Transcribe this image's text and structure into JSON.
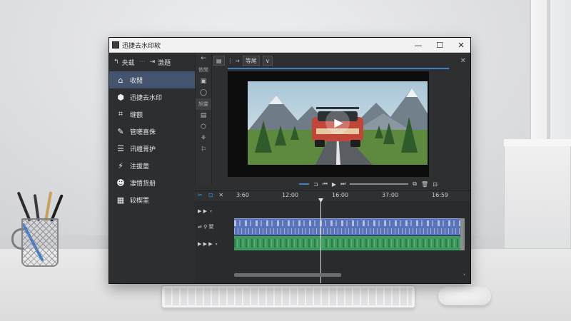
{
  "window": {
    "title": "迅捷去水印软",
    "controls": {
      "minimize": "—",
      "maximize": "☐",
      "close": "✕"
    }
  },
  "sidebar": {
    "top": {
      "back_label": "央载",
      "sep": "⋯",
      "right_label": "激題"
    },
    "items": [
      {
        "label": "收閒",
        "icon": "home-icon",
        "active": true
      },
      {
        "label": "迅捷去水印",
        "icon": "cube-icon",
        "active": false
      },
      {
        "label": "缝额",
        "icon": "crop-icon",
        "active": false
      },
      {
        "label": "管嗟喜侏",
        "icon": "edit-icon",
        "active": false
      },
      {
        "label": "讯缠膏护",
        "icon": "list-icon",
        "active": false
      },
      {
        "label": "注拔童",
        "icon": "wand-icon",
        "active": false
      },
      {
        "label": "凄悟货册",
        "icon": "people-icon",
        "active": false
      },
      {
        "label": "较楔罜",
        "icon": "grid-icon",
        "active": false
      }
    ]
  },
  "tools": {
    "back": "←",
    "items": [
      "侬閒",
      "▣",
      "◯",
      "旭靈",
      "▤",
      "⬡",
      "⚘",
      "⚐"
    ]
  },
  "preview_bar": {
    "left_icon": "⋮ →",
    "dropdown_label": "等尾",
    "dropdown_arrow": "∨",
    "close": "✕"
  },
  "transport": {
    "icons": [
      "⊐",
      "⏮",
      "▶",
      "⏭",
      "⧉",
      "🗑",
      "⊡"
    ]
  },
  "timeline": {
    "ticks": [
      "3:60",
      "12:00",
      "16:00",
      "37:00",
      "16:59"
    ],
    "tool_icons": [
      "✂",
      "⊡",
      "✕"
    ],
    "tracks": [
      {
        "label": "▶ ▶",
        "dd": "▾"
      },
      {
        "label": "⇌ ⚲ 聚",
        "dd": ""
      },
      {
        "label": "▶ ▶ ▶",
        "dd": "▾"
      }
    ],
    "scroll_right": "›"
  },
  "colors": {
    "accent": "#3f7fd0",
    "active_item": "#44536e",
    "video_track": "#5b73b9",
    "audio_track": "#3f9a5f"
  }
}
